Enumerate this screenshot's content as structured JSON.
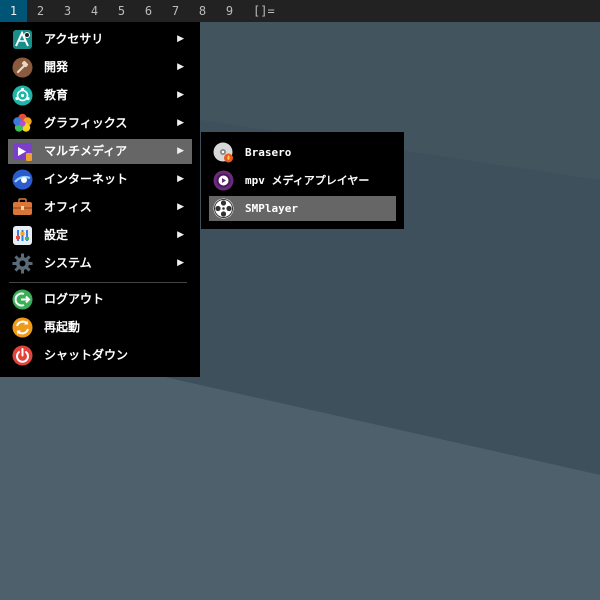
{
  "topbar": {
    "workspaces": [
      "1",
      "2",
      "3",
      "4",
      "5",
      "6",
      "7",
      "8",
      "9"
    ],
    "active_workspace": "1",
    "layout_symbol": "[]="
  },
  "main_menu": {
    "items": [
      {
        "label": "アクセサリ",
        "icon": "accessories-icon",
        "has_submenu": true
      },
      {
        "label": "開発",
        "icon": "development-icon",
        "has_submenu": true
      },
      {
        "label": "教育",
        "icon": "education-icon",
        "has_submenu": true
      },
      {
        "label": "グラフィックス",
        "icon": "graphics-icon",
        "has_submenu": true
      },
      {
        "label": "マルチメディア",
        "icon": "multimedia-icon",
        "has_submenu": true,
        "selected": true
      },
      {
        "label": "インターネット",
        "icon": "internet-icon",
        "has_submenu": true
      },
      {
        "label": "オフィス",
        "icon": "office-icon",
        "has_submenu": true
      },
      {
        "label": "設定",
        "icon": "settings-icon",
        "has_submenu": true
      },
      {
        "label": "システム",
        "icon": "system-icon",
        "has_submenu": true
      },
      {
        "label": "ログアウト",
        "icon": "logout-icon",
        "has_submenu": false
      },
      {
        "label": "再起動",
        "icon": "reboot-icon",
        "has_submenu": false
      },
      {
        "label": "シャットダウン",
        "icon": "shutdown-icon",
        "has_submenu": false
      }
    ],
    "submenu_arrow": "▶"
  },
  "sub_menu": {
    "items": [
      {
        "label": "Brasero",
        "icon": "brasero-icon"
      },
      {
        "label": "mpv メディアプレイヤー",
        "icon": "mpv-icon"
      },
      {
        "label": "SMPlayer",
        "icon": "smplayer-icon",
        "selected": true
      }
    ]
  },
  "colors": {
    "topbar_bg": "#222222",
    "active_workspace_bg": "#005577",
    "menu_bg": "#000000",
    "menu_selected_bg": "#666666",
    "wallpaper": "#4d5f6a"
  }
}
